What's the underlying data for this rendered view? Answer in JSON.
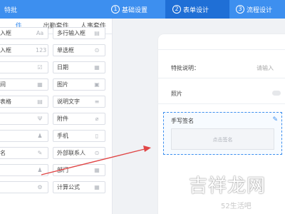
{
  "header": {
    "title": "特批",
    "steps": [
      {
        "num": "1",
        "label": "基础设置"
      },
      {
        "num": "2",
        "label": "表单设计"
      },
      {
        "num": "3",
        "label": "流程设计"
      }
    ],
    "active_color": "#1f6fd6",
    "bar_color": "#3d8fef"
  },
  "left": {
    "tabs": [
      {
        "label": "件"
      },
      {
        "label": "出勤套件"
      },
      {
        "label": "人事套件"
      }
    ],
    "controls": [
      {
        "label": "入框",
        "icon": "Aa"
      },
      {
        "label": "多行输入框",
        "icon": "▤"
      },
      {
        "label": "入框",
        "icon": "123"
      },
      {
        "label": "单选框",
        "icon": "⊙"
      },
      {
        "label": "",
        "icon": "☑"
      },
      {
        "label": "日期",
        "icon": "▦"
      },
      {
        "label": "间",
        "icon": "▦"
      },
      {
        "label": "图片",
        "icon": "▣"
      },
      {
        "label": "表格",
        "icon": "▤"
      },
      {
        "label": "说明文字",
        "icon": "≡"
      },
      {
        "label": "",
        "icon": "Ψ"
      },
      {
        "label": "附件",
        "icon": "⌀"
      },
      {
        "label": "",
        "icon": "♟"
      },
      {
        "label": "手机",
        "icon": "▯"
      },
      {
        "label": "名",
        "icon": "✎"
      },
      {
        "label": "外部联系人",
        "icon": "⊙"
      },
      {
        "label": "",
        "icon": "♟"
      },
      {
        "label": "部门",
        "icon": "▦"
      },
      {
        "label": "",
        "icon": "⚙"
      },
      {
        "label": "计算公式",
        "icon": "▦"
      }
    ]
  },
  "phone": {
    "fields": [
      {
        "label": "特批说明：",
        "value": "请输入"
      },
      {
        "label": "照片",
        "value": ""
      }
    ],
    "signature": {
      "label": "手写签名",
      "placeholder": "点击签名"
    }
  },
  "watermark": {
    "main": "吉祥龙网",
    "sub": "52生活吧"
  }
}
